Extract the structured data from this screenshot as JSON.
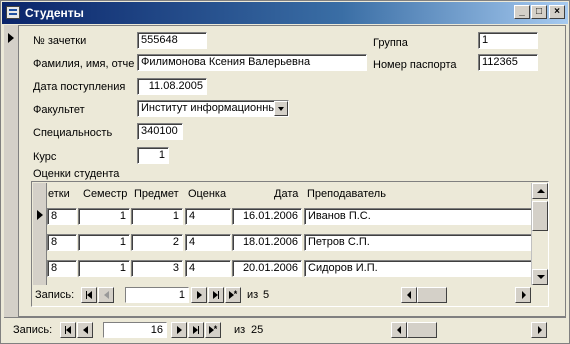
{
  "window": {
    "title": "Студенты",
    "controls": [
      "_",
      "□",
      "×"
    ]
  },
  "form": {
    "fields": [
      {
        "label": "№ зачетки",
        "value": "555648"
      },
      {
        "label": "Фамилия, имя, отче",
        "value": "Филимонова Ксения Валерьевна"
      },
      {
        "label": "Дата поступления",
        "value": "11.08.2005"
      },
      {
        "label": "Факультет",
        "value": "Институт информационны"
      },
      {
        "label": "Специальность",
        "value": "340100"
      },
      {
        "label": "Курс",
        "value": "1"
      },
      {
        "label": "Группа",
        "value": "1"
      },
      {
        "label": "Номер паспорта",
        "value": "112365"
      }
    ],
    "subform_label": "Оценки студента"
  },
  "grades": {
    "columns": [
      "етки",
      "Семестр",
      "Предмет",
      "Оценка",
      "Дата",
      "Преподаватель"
    ],
    "rows": [
      [
        "8",
        "1",
        "1",
        "4",
        "16.01.2006",
        "Иванов П.С."
      ],
      [
        "8",
        "1",
        "2",
        "4",
        "18.01.2006",
        "Петров С.П."
      ],
      [
        "8",
        "1",
        "3",
        "4",
        "20.01.2006",
        "Сидоров И.П."
      ]
    ],
    "nav": {
      "label": "Запись:",
      "current": "1",
      "of_label": "из",
      "total": "5"
    }
  },
  "main_nav": {
    "label": "Запись:",
    "current": "16",
    "of_label": "из",
    "total": "25"
  }
}
